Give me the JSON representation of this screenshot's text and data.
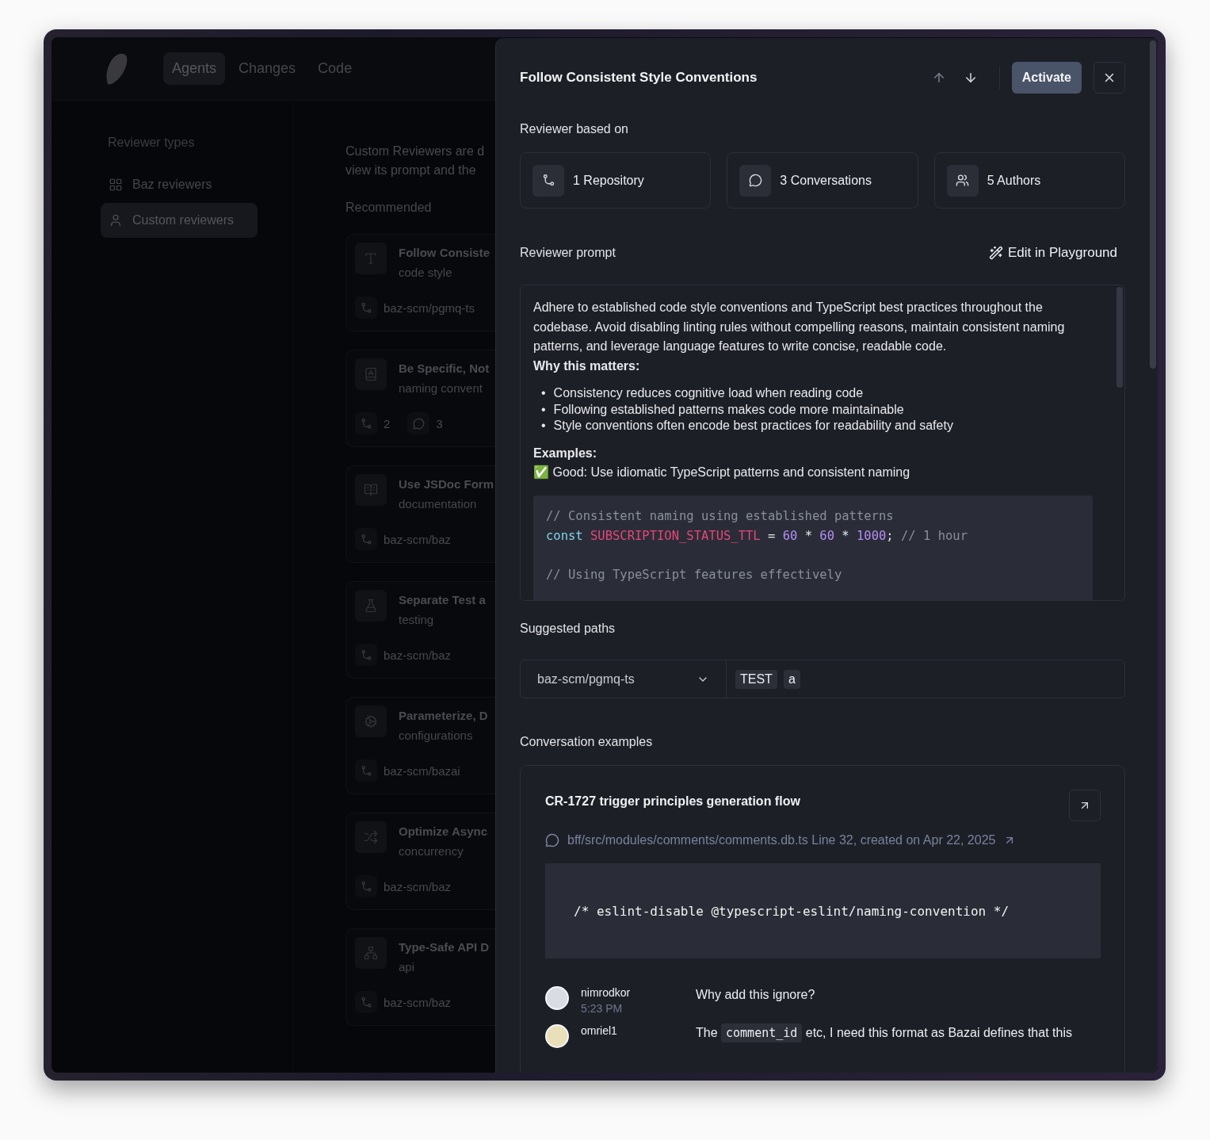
{
  "app": {
    "nav": {
      "tabs": [
        {
          "label": "Agents",
          "selected": true
        },
        {
          "label": "Changes",
          "selected": false
        },
        {
          "label": "Code",
          "selected": false
        }
      ]
    },
    "sidebar": {
      "heading": "Reviewer types",
      "items": [
        {
          "label": "Baz reviewers",
          "selected": false
        },
        {
          "label": "Custom reviewers",
          "selected": true
        }
      ]
    },
    "main": {
      "intro_lines": [
        "Custom Reviewers are d",
        "view its prompt and the"
      ],
      "section_title": "Recommended",
      "cards": [
        {
          "title": "Follow Consiste",
          "subtitle": "code style",
          "meta": [
            {
              "kind": "repo",
              "text": "baz-scm/pgmq-ts"
            }
          ]
        },
        {
          "title": "Be Specific, Not",
          "subtitle": "naming convent",
          "meta": [
            {
              "kind": "repo",
              "text": "2"
            },
            {
              "kind": "comments",
              "text": "3"
            }
          ]
        },
        {
          "title": "Use JSDoc Form",
          "subtitle": "documentation",
          "meta": [
            {
              "kind": "repo",
              "text": "baz-scm/baz"
            }
          ]
        },
        {
          "title": "Separate Test a",
          "subtitle": "testing",
          "meta": [
            {
              "kind": "repo",
              "text": "baz-scm/baz"
            }
          ]
        },
        {
          "title": "Parameterize, D",
          "subtitle": "configurations",
          "meta": [
            {
              "kind": "repo",
              "text": "baz-scm/bazai"
            }
          ]
        },
        {
          "title": "Optimize Async",
          "subtitle": "concurrency",
          "meta": [
            {
              "kind": "repo",
              "text": "baz-scm/baz"
            }
          ]
        },
        {
          "title": "Type-Safe API D",
          "subtitle": "api",
          "meta": [
            {
              "kind": "repo",
              "text": "baz-scm/baz"
            }
          ]
        }
      ]
    }
  },
  "drawer": {
    "title": "Follow Consistent Style Conventions",
    "move_up": {
      "disabled": true
    },
    "move_down": {
      "disabled": false
    },
    "primary_action": "Activate",
    "based_on": {
      "label": "Reviewer based on",
      "stats": [
        {
          "text": "1 Repository"
        },
        {
          "text": "3 Conversations"
        },
        {
          "text": "5 Authors"
        }
      ]
    },
    "prompt": {
      "label": "Reviewer prompt",
      "edit_action": "Edit in Playground",
      "intro": "Adhere to established code style conventions and TypeScript best practices throughout the codebase. Avoid disabling linting rules without compelling reasons, maintain consistent naming patterns, and leverage language features to write concise, readable code.",
      "why_heading": "Why this matters:",
      "bullets": [
        {
          "marker": "•",
          "text": "Consistency reduces cognitive load when reading code"
        },
        {
          "marker": "•",
          "text": "Following established patterns makes code more maintainable"
        },
        {
          "marker": "•",
          "text": "Style conventions often encode best practices for readability and safety"
        }
      ],
      "examples_heading": "Examples:",
      "good_example": "✅ Good: Use idiomatic TypeScript patterns and consistent naming",
      "code_groups": [
        {
          "lines": [
            [
              {
                "kind": "comment",
                "text": "// Consistent naming using established patterns"
              }
            ],
            [
              {
                "kind": "keyword",
                "text": "const"
              },
              {
                "kind": "constant",
                "text": "SUBSCRIPTION_STATUS_TTL"
              },
              {
                "kind": "plain",
                "text": " = "
              },
              {
                "kind": "number",
                "text": "60"
              },
              {
                "kind": "plain",
                "text": " * "
              },
              {
                "kind": "number",
                "text": "60"
              },
              {
                "kind": "plain",
                "text": " * "
              },
              {
                "kind": "number",
                "text": "1000"
              },
              {
                "kind": "plain",
                "text": "; "
              },
              {
                "kind": "comment",
                "text": "// 1 hour"
              }
            ]
          ]
        },
        {
          "lines": [
            [
              {
                "kind": "comment",
                "text": "// Using TypeScript features effectively"
              }
            ]
          ]
        }
      ]
    },
    "suggested_paths": {
      "label": "Suggested paths",
      "repository": "baz-scm/pgmq-ts",
      "tags": [
        "TEST",
        "a"
      ]
    },
    "conversations": {
      "label": "Conversation examples",
      "items": [
        {
          "title": "CR-1727 trigger principles generation flow",
          "location": "bff/src/modules/comments/comments.db.ts Line 32, created on Apr 22, 2025",
          "code": "/* eslint-disable @typescript-eslint/naming-convention */",
          "comments": [
            {
              "author": "nimrodkor",
              "time": "5:23 PM",
              "message": [
                {
                  "kind": "text",
                  "text": "Why add this ignore?"
                }
              ]
            },
            {
              "author": "omriel1",
              "message": [
                {
                  "kind": "text",
                  "text": "The "
                },
                {
                  "kind": "code",
                  "text": "comment_id"
                },
                {
                  "kind": "text",
                  "text": " etc, I need this format as Bazai defines that this"
                }
              ]
            }
          ]
        }
      ]
    }
  }
}
